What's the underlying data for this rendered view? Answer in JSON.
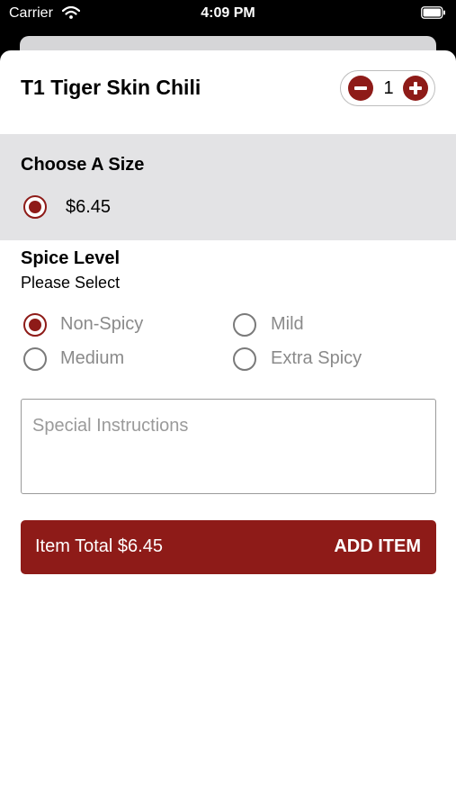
{
  "status_bar": {
    "carrier": "Carrier",
    "time": "4:09 PM",
    "wifi_icon": "wifi-icon",
    "battery_icon": "battery-icon"
  },
  "item": {
    "title": "T1 Tiger Skin Chili",
    "quantity": "1",
    "minus_icon": "minus-circle-icon",
    "plus_icon": "plus-circle-icon"
  },
  "size_section": {
    "heading": "Choose A Size",
    "options": [
      {
        "label": "$6.45",
        "selected": true
      }
    ]
  },
  "spice_section": {
    "heading": "Spice Level",
    "subheading": "Please Select",
    "options": [
      {
        "label": "Non-Spicy",
        "selected": true
      },
      {
        "label": "Mild",
        "selected": false
      },
      {
        "label": "Medium",
        "selected": false
      },
      {
        "label": "Extra Spicy",
        "selected": false
      }
    ]
  },
  "instructions": {
    "placeholder": "Special Instructions",
    "value": ""
  },
  "add_button": {
    "total_text": "Item Total $6.45",
    "action_text": "ADD ITEM"
  },
  "colors": {
    "accent": "#8e1b18",
    "section_bg": "#e3e3e5",
    "option_text": "#8a8a8a"
  }
}
